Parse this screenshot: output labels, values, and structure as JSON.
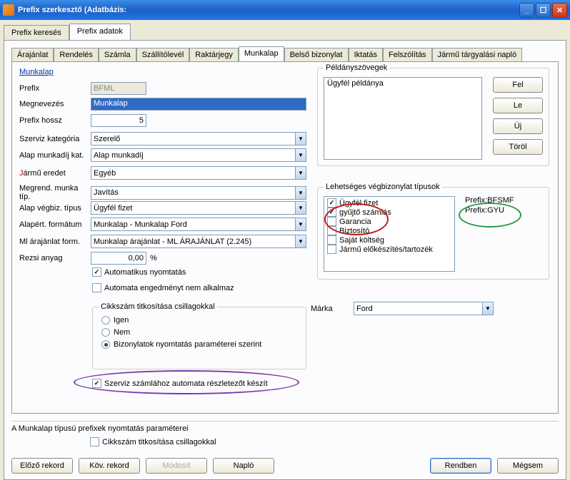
{
  "window": {
    "title": "Prefix szerkesztő  (Adatbázis:",
    "title_tail": "                                                             "
  },
  "mainTabs": [
    "Prefix keresés",
    "Prefix adatok"
  ],
  "subTabs": [
    "Árajánlat",
    "Rendelés",
    "Számla",
    "Szállítólevél",
    "Raktárjegy",
    "Munkalap",
    "Belső bizonylat",
    "Iktatás",
    "Felszólítás",
    "Jármű tárgyalási napló"
  ],
  "sectionTitle": "Munkalap",
  "fields": {
    "prefix": {
      "label": "Prefix",
      "value": "BFML"
    },
    "megnevezes": {
      "label": "Megnevezés",
      "value": "Munkalap"
    },
    "prefixHossz": {
      "label": "Prefix hossz",
      "value": "5"
    },
    "szervizKat": {
      "label": "Szerviz kategória",
      "value": "Szerelő"
    },
    "alapMunkadij": {
      "label": "Alap munkadíj kat.",
      "value": "Alap munkadíj"
    },
    "jarmu": {
      "labelJ": "J",
      "labelRest": "ármű eredet",
      "value": "Egyéb"
    },
    "megrend": {
      "label": "Megrend. munka típ.",
      "value": "Javítás"
    },
    "alapVegbiz": {
      "label": "Alap végbiz. típus",
      "value": "Ügyfél fizet"
    },
    "alapertFormatum": {
      "label": "Alapért. formátum",
      "value": "Munkalap - Munkalap Ford"
    },
    "mlArajanlat": {
      "label": "Ml árajánlat form.",
      "value": "Munkalap árajánlat - ML ÁRAJÁNLAT (2.245)"
    },
    "rezsiAnyag": {
      "label": "Rezsi anyag",
      "value": "0,00",
      "unit": "%"
    },
    "autoNyomtatas": {
      "label": "Automatikus nyomtatás"
    },
    "autoEngedmeny": {
      "label": "Automata engedményt nem alkalmaz"
    }
  },
  "cikkszamGroup": {
    "title": "Cikkszám titkosítása csillagokkal",
    "options": [
      "Igen",
      "Nem",
      "Bizonylatok nyomtatás paraméterei szerint"
    ]
  },
  "szervizSzamla": "Szerviz számlához automata részletezőt készít",
  "peldany": {
    "title": "Példányszövegek",
    "item": "Ügyfél példánya",
    "btnFel": "Fel",
    "btnLe": "Le",
    "btnUj": "Új",
    "btnTorol": "Töröl"
  },
  "vegbiz": {
    "title": "Lehetséges végbizonylat típusok",
    "items": [
      {
        "label": "Ügyfél fizet",
        "checked": true
      },
      {
        "label": "gyűjtő számlás",
        "checked": true
      },
      {
        "label": "Garancia",
        "checked": false
      },
      {
        "label": "Biztosító",
        "checked": false
      },
      {
        "label": "Saját költség",
        "checked": false
      },
      {
        "label": "Jármű előkészítés/tartozék",
        "checked": false
      }
    ],
    "prefix1": "Prefix:BFSMF",
    "prefix2": "Prefix:GYU"
  },
  "marka": {
    "label": "Márka",
    "value": "Ford"
  },
  "bottomSection": {
    "title": "A Munkalap típusú prefixek nyomtatás paraméterei",
    "cikkszam": "Cikkszám titkosítása csillagokkal"
  },
  "bottomBtns": {
    "elozo": "Előző rekord",
    "kov": "Köv. rekord",
    "modosit": "Módosít",
    "naplo": "Napló",
    "rendben": "Rendben",
    "megsem": "Mégsem"
  }
}
